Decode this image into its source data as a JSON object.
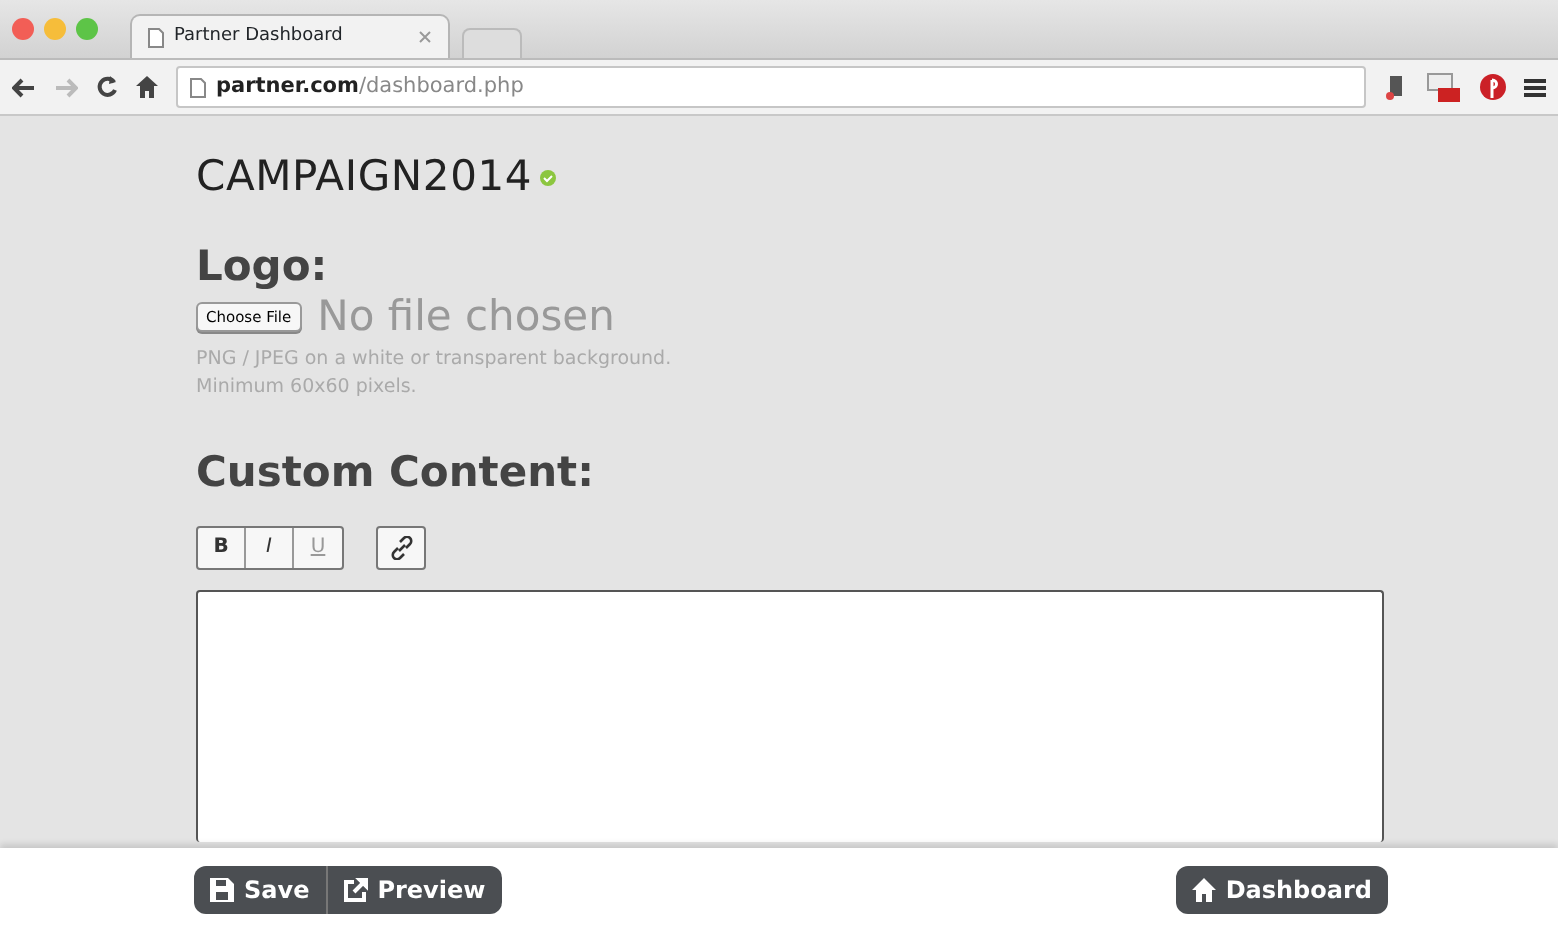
{
  "browser": {
    "tab_title": "Partner Dashboard",
    "url_host": "partner.com",
    "url_path": "/dashboard.php"
  },
  "campaign": {
    "title": "CAMPAIGN2014"
  },
  "logo": {
    "heading": "Logo:",
    "choose_button": "Choose File",
    "file_status": "No file chosen",
    "help": [
      "PNG / JPEG on a white or transparent background.",
      "Minimum 60x60 pixels."
    ]
  },
  "custom_content": {
    "heading": "Custom Content:",
    "format_buttons": [
      {
        "label": "B",
        "kind": "bold"
      },
      {
        "label": "I",
        "kind": "italic"
      },
      {
        "label": "U",
        "kind": "underline"
      }
    ]
  },
  "footer": {
    "left_buttons": [
      {
        "label": "Save",
        "kind": "save"
      },
      {
        "label": "Preview",
        "kind": "preview"
      }
    ],
    "right_button": {
      "label": "Dashboard",
      "kind": "home"
    }
  }
}
